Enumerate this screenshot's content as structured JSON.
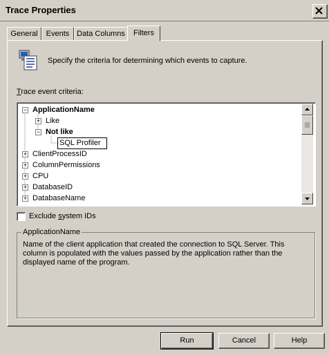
{
  "window": {
    "title": "Trace Properties"
  },
  "tabs": [
    {
      "label": "General"
    },
    {
      "label": "Events"
    },
    {
      "label": "Data Columns"
    },
    {
      "label": "Filters",
      "active": true
    }
  ],
  "filters": {
    "instruction": "Specify the criteria for determining which events to capture.",
    "criteria_label_u": "T",
    "criteria_label_rest": "race event criteria:",
    "tree": {
      "root": "ApplicationName",
      "like": "Like",
      "not_like": "Not like",
      "edit_value": "SQL Profiler",
      "items": [
        "ClientProcessID",
        "ColumnPermissions",
        "CPU",
        "DatabaseID",
        "DatabaseName"
      ]
    },
    "exclude_label_pre": "Exclude ",
    "exclude_label_u": "s",
    "exclude_label_post": "ystem IDs",
    "exclude_checked": false,
    "group_title": "ApplicationName",
    "description": "Name of the client application that created the connection to SQL Server. This column is populated with the values passed by the application rather than the displayed name of the program."
  },
  "buttons": {
    "run": "Run",
    "cancel": "Cancel",
    "help": "Help"
  }
}
